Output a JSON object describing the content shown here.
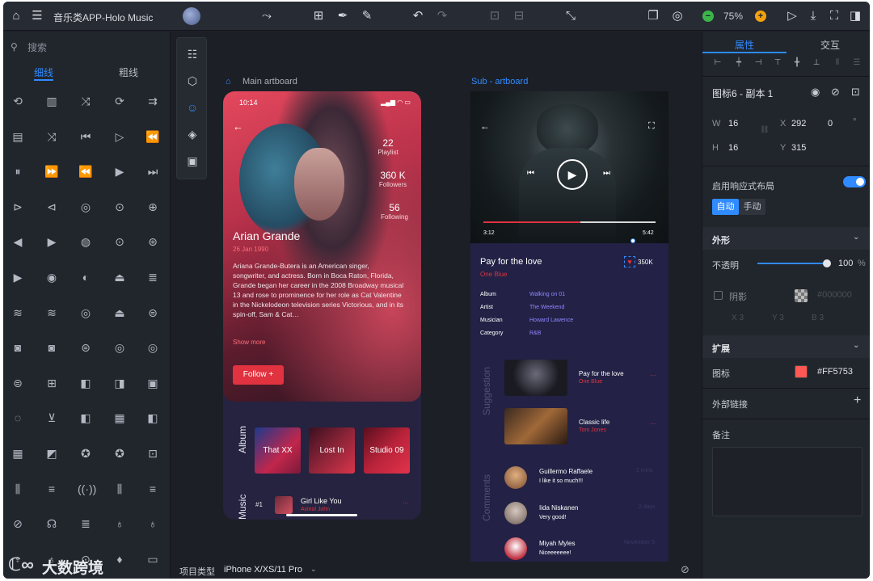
{
  "app": {
    "title": "音乐类APP-Holo Music",
    "zoom": "75%",
    "watermark": "大数跨境"
  },
  "left_panel": {
    "search_placeholder": "搜索",
    "tabs": [
      {
        "label": "细线",
        "active": true
      },
      {
        "label": "粗线",
        "active": false
      }
    ],
    "icon_names": [
      "repeat-one",
      "equalizer",
      "shuffle",
      "repeat",
      "next-list",
      "playlist",
      "shuffle",
      "skip-prev",
      "play-outline",
      "rewind",
      "pause",
      "fast-forward",
      "fast-rewind",
      "play",
      "skip-next",
      "play-next",
      "prev",
      "stop-circle",
      "play-circle",
      "playlist-add",
      "prev-circle",
      "next-circle",
      "pause-circle",
      "play-circle",
      "fast-forward-circle",
      "next-circle",
      "record-circle",
      "music-circle",
      "eject-circle",
      "list-circle",
      "sound-wave",
      "sound-wave",
      "stop-circle",
      "eject-circle",
      "eject-box",
      "stop-box",
      "stop-box",
      "eject-box",
      "stop-circle",
      "stop-circle",
      "eject-box",
      "pause-box",
      "prev-box",
      "next-box",
      "play-box",
      "wifi-box",
      "download-box",
      "prev-box",
      "film-box",
      "prev-box",
      "film",
      "clapperboard",
      "film-reel",
      "film-reel",
      "video-box",
      "mixer",
      "sliders",
      "broadcast",
      "mixer",
      "sliders",
      "mic-off",
      "headphones",
      "mic-stand",
      "mic",
      "mic",
      "mic-vintage",
      "mic",
      "play-circle",
      "mic-box",
      "video-frame"
    ]
  },
  "vertical_toolbar": [
    "layers-icon",
    "cube-icon",
    "smile-icon",
    "stack-icon",
    "panel-icon"
  ],
  "canvas": {
    "main_label": "Main artboard",
    "sub_label": "Sub - artboard"
  },
  "main_artboard": {
    "time": "10:14",
    "stats": [
      {
        "value": "22",
        "label": "Playlist"
      },
      {
        "value": "360 K",
        "label": "Followers"
      },
      {
        "value": "56",
        "label": "Following"
      }
    ],
    "name": "Arian Grande",
    "date": "26 Jan 1990",
    "bio": "Ariana Grande-Butera is an American singer, songwriter, and actress. Born in Boca Raton, Florida, Grande began her career in the 2008 Broadway musical 13 and rose to prominence for her role as Cat Valentine in the Nickelodeon television series Victorious, and in its spin-off, Sam & Cat…",
    "show_more": "Show more",
    "follow": "Follow +",
    "album_label": "Album",
    "albums": [
      "That XX",
      "Lost In",
      "Studio 09"
    ],
    "music_label": "Music",
    "track_no": "#1",
    "track_title": "Girl Like You",
    "track_artist": "Avinol John"
  },
  "sub_artboard": {
    "time_current": "3:12",
    "time_total": "5:42",
    "song_title": "Pay for the love",
    "song_subtitle": "One Blue",
    "likes": "350K",
    "meta": [
      {
        "k": "Album",
        "v": "Walking on 01"
      },
      {
        "k": "Artist",
        "v": "The Weekend"
      },
      {
        "k": "Musician",
        "v": "Howard Lawence"
      },
      {
        "k": "Category",
        "v": "R&B"
      }
    ],
    "suggestion_label": "Suggestion",
    "suggestions": [
      {
        "title": "Pay for the love",
        "sub": "One Blue"
      },
      {
        "title": "Classic life",
        "sub": "Tom Jones"
      }
    ],
    "comments_label": "Comments",
    "comments": [
      {
        "name": "Guillermo Raffaele",
        "text": "I like it so much!!!",
        "time": "2 mins"
      },
      {
        "name": "Iida Niskanen",
        "text": "Very good!",
        "time": "2 days"
      },
      {
        "name": "Miyah Myles",
        "text": "Niceeeeeee!",
        "time": "November 5"
      }
    ]
  },
  "right_panel": {
    "tabs": [
      {
        "label": "属性",
        "active": true
      },
      {
        "label": "交互",
        "active": false
      }
    ],
    "layer_name": "图标6 - 副本 1",
    "w_label": "W",
    "w": "16",
    "x_label": "X",
    "x": "292",
    "rot": "0",
    "rot_unit": "°",
    "h_label": "H",
    "h": "16",
    "y_label": "Y",
    "y": "315",
    "responsive_label": "启用响应式布局",
    "mode_auto": "自动",
    "mode_manual": "手动",
    "section_appearance": "外形",
    "opacity_label": "不透明",
    "opacity_value": "100",
    "opacity_unit": "%",
    "opacity_fraction": 1.0,
    "shadow_label": "阴影",
    "shadow_color": "#000000",
    "shadow_x": "X  3",
    "shadow_y": "Y  3",
    "shadow_b": "B  3",
    "section_extend": "扩展",
    "icon_label": "图标",
    "icon_color": "#FF5753",
    "link_label": "外部链接",
    "note_label": "备注"
  },
  "bottom_bar": {
    "project_type_label": "项目类型",
    "device": "iPhone X/XS/11 Pro"
  },
  "colors": {
    "accent": "#2f8bff",
    "red": "#e0333f",
    "icon_swatch": "#FF5753"
  }
}
